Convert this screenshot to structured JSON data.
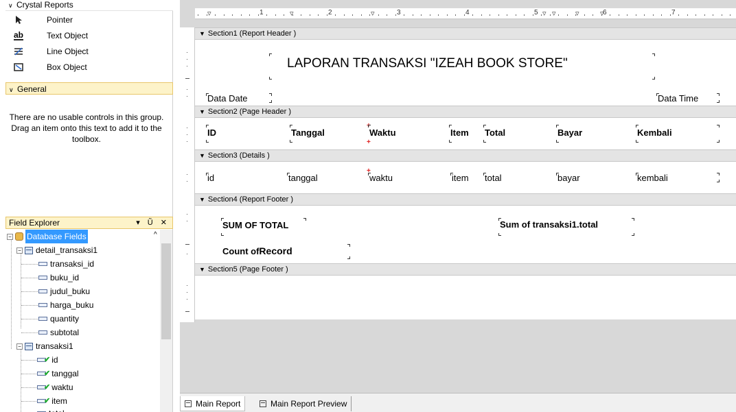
{
  "toolbox": {
    "crystal_group": "Crystal Reports",
    "items": [
      {
        "label": "Pointer",
        "icon": "pointer-icon"
      },
      {
        "label": "Text Object",
        "icon": "text-object-icon",
        "glyph": "ab"
      },
      {
        "label": "Line Object",
        "icon": "line-object-icon"
      },
      {
        "label": "Box Object",
        "icon": "box-object-icon"
      }
    ],
    "general_group": "General",
    "general_message": "There are no usable controls in this group. Drag an item onto this text to add it to the toolbox."
  },
  "field_explorer": {
    "title": "Field Explorer",
    "pin_glyph": "▾ Ũ ✕",
    "root": "Database Fields",
    "tables": [
      {
        "name": "detail_transaksi1",
        "fields": [
          "transaksi_id",
          "buku_id",
          "judul_buku",
          "harga_buku",
          "quantity",
          "subtotal"
        ]
      },
      {
        "name": "transaksi1",
        "fields": [
          "id",
          "tanggal",
          "waktu",
          "item",
          "total"
        ]
      }
    ]
  },
  "ruler": {
    "numbers": [
      "1",
      "2",
      "3",
      "4",
      "5",
      "6",
      "7"
    ]
  },
  "sections": {
    "s1": "Section1 (Report Header )",
    "s2": "Section2 (Page Header )",
    "s3": "Section3 (Details )",
    "s4": "Section4 (Report Footer )",
    "s5": "Section5 (Page Footer )"
  },
  "report": {
    "title": "LAPORAN TRANSAKSI \"IZEAH BOOK STORE\"",
    "data_date": "Data Date",
    "data_time": "Data Time",
    "headers": [
      "ID",
      "Tanggal",
      "Waktu",
      "Item",
      "Total",
      "Bayar",
      "Kembali"
    ],
    "details": [
      "id",
      "tanggal",
      "waktu",
      "item",
      "total",
      "bayar",
      "kembali"
    ],
    "sum_label": "SUM OF TOTAL",
    "sum_field": "Sum of transaksi1.total",
    "count_label_a": "Count of",
    "count_label_b": "Record"
  },
  "tabs": {
    "main": "Main Report",
    "preview": "Main Report Preview"
  }
}
